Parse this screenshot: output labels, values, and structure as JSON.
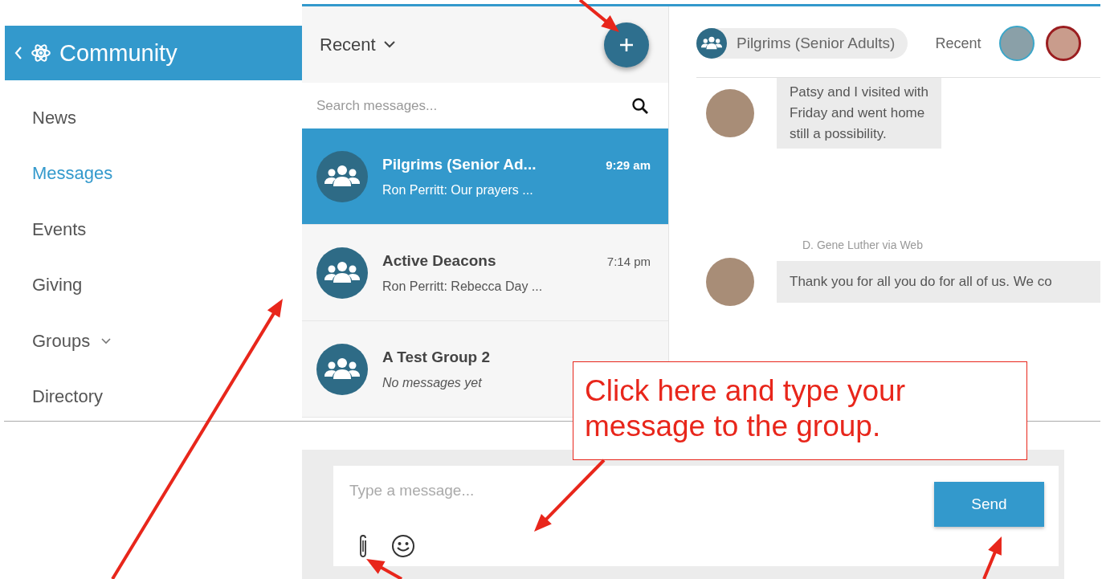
{
  "sidebar": {
    "title": "Community",
    "items": [
      {
        "label": "News",
        "selected": false,
        "kind": "link"
      },
      {
        "label": "Messages",
        "selected": true,
        "kind": "link"
      },
      {
        "label": "Events",
        "selected": false,
        "kind": "link"
      },
      {
        "label": "Giving",
        "selected": false,
        "kind": "link"
      },
      {
        "label": "Groups",
        "selected": false,
        "kind": "group"
      },
      {
        "label": "Directory",
        "selected": false,
        "kind": "link"
      }
    ]
  },
  "conversation_list": {
    "filter": "Recent",
    "search": {
      "placeholder": "Search messages..."
    },
    "conversations": [
      {
        "name": "Pilgrims (Senior Ad...",
        "time": "9:29 am",
        "preview": "Ron Perritt: Our prayers ...",
        "selected": true,
        "kind": "message"
      },
      {
        "name": "Active Deacons",
        "time": "7:14 pm",
        "preview": "Ron Perritt: Rebecca Day ...",
        "selected": false,
        "kind": "message"
      },
      {
        "name": "A Test Group 2",
        "preview": "No messages yet",
        "selected": false,
        "kind": "empty"
      }
    ]
  },
  "chat": {
    "group": "Pilgrims (Senior Adults)",
    "recent_label": "Recent",
    "messages": [
      {
        "lines": [
          "Patsy and I visited with",
          "Friday and went home",
          "still a possibility."
        ]
      },
      {
        "sender": "D. Gene Luther via Web",
        "lines": [
          "Thank you for all you do for all of us. We co"
        ]
      }
    ]
  },
  "composer": {
    "placeholder": "Type a message...",
    "send": "Send"
  },
  "callout": {
    "text": "Click here and type your message to the group."
  }
}
